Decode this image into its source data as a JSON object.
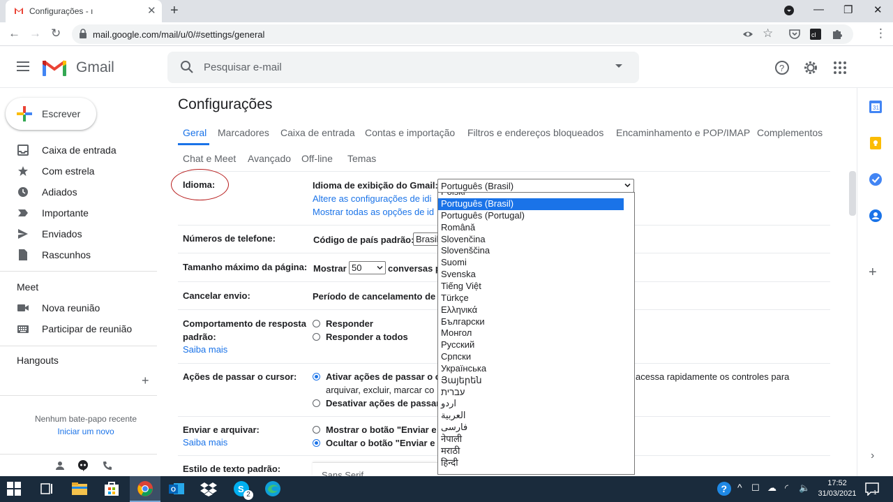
{
  "browser": {
    "tab_title": "Configurações - ı",
    "url": "mail.google.com/mail/u/0/#settings/general"
  },
  "gmail": {
    "brand": "Gmail",
    "search_placeholder": "Pesquisar e-mail"
  },
  "nav": {
    "compose": "Escrever",
    "items": [
      {
        "label": "Caixa de entrada",
        "icon": "inbox-icon"
      },
      {
        "label": "Com estrela",
        "icon": "star-icon"
      },
      {
        "label": "Adiados",
        "icon": "clock-icon"
      },
      {
        "label": "Importante",
        "icon": "important-icon"
      },
      {
        "label": "Enviados",
        "icon": "send-icon"
      },
      {
        "label": "Rascunhos",
        "icon": "draft-icon"
      }
    ],
    "meet_title": "Meet",
    "meet_items": [
      {
        "label": "Nova reunião",
        "icon": "video-icon"
      },
      {
        "label": "Participar de reunião",
        "icon": "keyboard-icon"
      }
    ],
    "hangouts_title": "Hangouts",
    "no_chat": "Nenhum bate-papo recente",
    "start_new": "Iniciar um novo"
  },
  "settings": {
    "title": "Configurações",
    "tabs_row1": [
      "Geral",
      "Marcadores",
      "Caixa de entrada",
      "Contas e importação",
      "Filtros e endereços bloqueados",
      "Encaminhamento e POP/IMAP",
      "Complementos"
    ],
    "tabs_row2": [
      "Chat e Meet",
      "Avançado",
      "Off-line",
      "Temas"
    ],
    "language": {
      "label": "Idioma:",
      "display_label": "Idioma de exibição do Gmail:",
      "selected": "Português (Brasil)",
      "link1": "Altere as configurações de idi",
      "link2": "Mostrar todas as opções de id",
      "options_partial_top": "Polski",
      "options": [
        "Português (Brasil)",
        "Português (Portugal)",
        "Română",
        "Slovenčina",
        "Slovenščina",
        "Suomi",
        "Svenska",
        "Tiếng Việt",
        "Türkçe",
        "Ελληνικά",
        "Български",
        "Монгол",
        "Русский",
        "Српски",
        "Українська",
        "Յայերեն",
        "עברית",
        "اردو",
        "العربية",
        "فارسی",
        "नेपाली",
        "मराठी",
        "हिन्दी"
      ]
    },
    "phone": {
      "label": "Números de telefone:",
      "text": "Código de país padrão:",
      "value": "Brasil"
    },
    "pagesize": {
      "label": "Tamanho máximo da página:",
      "prefix": "Mostrar",
      "value": "50",
      "suffix": "conversas p"
    },
    "undo": {
      "label": "Cancelar envio:",
      "text": "Período de cancelamento de e"
    },
    "reply": {
      "label1": "Comportamento de resposta",
      "label2": "padrão:",
      "learn_more": "Saiba mais",
      "opt1": "Responder",
      "opt2": "Responder a todos"
    },
    "hover": {
      "label": "Ações de passar o cursor:",
      "opt1": "Ativar ações de passar o c",
      "opt1_rest": "acessa rapidamente os controles para",
      "opt1_line2": "arquivar, excluir, marcar co",
      "opt2": "Desativar ações de passar"
    },
    "sendarchive": {
      "label": "Enviar e arquivar:",
      "learn_more": "Saiba mais",
      "opt1": "Mostrar o botão \"Enviar e a",
      "opt2": "Ocultar o botão \"Enviar e a"
    },
    "textstyle": {
      "label": "Estilo de texto padrão:",
      "font": "Sans Serif"
    }
  },
  "taskbar": {
    "time": "17:52",
    "date": "31/03/2021",
    "skype_badge": "2"
  },
  "colors": {
    "accent": "#1a73e8",
    "taskbar": "#1a2b3c",
    "annotation": "#b71c1c"
  }
}
